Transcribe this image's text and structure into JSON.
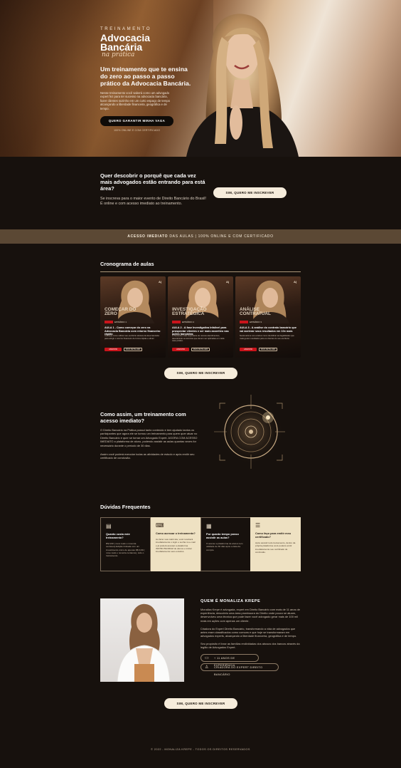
{
  "hero": {
    "eyebrow": "TREINAMENTO",
    "title_line1": "Advocacia",
    "title_line2": "Bancária",
    "script": "na prática",
    "headline": "Um treinamento que te ensina do zero ao passo a passo prático da Advocacia Bancária.",
    "body": "Nesse treinamento você saberá como um advogado expert fez para ter sucesso na advocacia bancária, fazer clientes sozinho em um curto espaço de tempo alcançando a liberdade financeira, geográfica e de tempo.",
    "cta": "QUERO GARANTIR MINHA VAGA",
    "note": "100% ONLINE E COM CERTIFICADO"
  },
  "why": {
    "heading": "Quer descobrir o porquê que cada vez mais advogados estão entrando para está área?",
    "body": "Se inscreva para o maior evento de Direito Bancário do Brasil! É online e com acesso imediato ao treinamento.",
    "cta": "SIM, QUERO ME INSCREVER"
  },
  "banner": {
    "bold": "ACESSO IMEDIATO",
    "rest": " DAS AULAS | 100% ONLINE E COM CERTIFICADO"
  },
  "schedule": {
    "title": "Cronograma de aulas",
    "cards": [
      {
        "big": "COMEÇAR DO ZERO",
        "tag": "EPISÓDIO 1",
        "title": "AULA 1 - Como começar do zero na Advocacia Bancária com retorno financeiro rápido",
        "desc": "Conheça como utilizar seu escritório através da área bancária para atingir o retorno financeiro de forma rápida e eficaz.",
        "btn1": "ASSISTIR",
        "btn2": "MAIS DETALHES",
        "logo": "A|"
      },
      {
        "big": "INVESTIGAÇÃO ESTRATÉGICA",
        "tag": "EPISÓDIO 2",
        "title": "AULA 2 - A fase Investigativa Infalível para prospectar clientes e ser mais assertivo nas ações bancárias",
        "desc": "O momento mais importante de nossos atendimentos, descobrindo as técnicas que devem ser aplicadas em cada caso prático.",
        "btn1": "ASSISTIR",
        "btn2": "MAIS DETALHES",
        "logo": "A|"
      },
      {
        "big": "ANÁLISE CONTRATUAL",
        "tag": "EPISÓDIO 3",
        "title": "AULA 3 - A análise do contrato bancário que vai acelerar seus resultados em 10x mais",
        "desc": "Nesta aula te vou ensinar como identificar as ilegalidades que mais geram resultados para os clientes do seu escritório.",
        "btn1": "ASSISTIR",
        "btn2": "MAIS DETALHES",
        "logo": "A|"
      }
    ],
    "cta": "SIM, QUERO ME INSCREVER"
  },
  "access": {
    "heading": "Como assim, um treinamento com acesso imediato?",
    "body": "O Direito Bancário na Prática possui tanto conteúdo e tem ajudado tantos os participantes que agora ele se tornou um treinamento para quem quer atuar no Direito Bancário e quer se tornar um Advogado Expert. AGORA COM ACESSO IMEDIATO a plataforma de aluno, podendo assistir as aulas quantas vezes for necessário durante o período de 30 dias.",
    "body2": "Assim você poderá executar todas as atividades de estudo e após emitir seu certificado de conclusão."
  },
  "faq": {
    "title": "Dúvidas Frequentes",
    "items": [
      {
        "icon": "money-icon",
        "glyph": "▤",
        "q": "Quanto custa este treinamento?",
        "a": "R$ 9,90 ( nove reais e noventa centavos) Edição limitada com um investimento único de apenas R$ 9,90 ( nove reais e noventa centavos), todo o treinamento."
      },
      {
        "icon": "laptop-icon",
        "glyph": "⌨",
        "q": "Como acessar o treinamento?",
        "a": "Ao fazer sua matrícula, você receberá imediatamente o login e senha no e-mail e já poderá acessar a plataforma INSTRUTEORIAZ de alunos e iniciar imediatamente seus estudos."
      },
      {
        "icon": "calendar-icon",
        "glyph": "▦",
        "q": "Por quanto tempo posso assistir as aulas?",
        "a": "O acesso a plataforma de alunos tem validade de 30 dias após a data da compra."
      },
      {
        "icon": "certificate-icon",
        "glyph": "☰",
        "q": "Como faço para emitir meu certificado?",
        "a": "Após assistir todo treinamento, dentro da própria plataforma você poderá emitir imediatamente seu certificado de conclusão."
      }
    ]
  },
  "about": {
    "heading": "QUEM É MONALIZA KREPE",
    "p1": "Monaliza Krepe é advogada, expert em Direito Bancário com mais de 11 anos de experiência, descobriu uma área promissora do Direito onde pouco se atuam, desenvolveu uma técnica que pode fazer você advogado gerar mais de 100 mil reais em ações com apenas um cliente.",
    "p2": "Criadora do Expert Direito Bancário, transformando a vida de advogados que antes eram classificados como comuns e que hoje se transformaram em advogados experts, alcançando a liberdade financeira, geográfica e de tempo.",
    "p3": "Seu propósito é livrar as famílias endividadas dos abusos dos bancos através da legião de Advogados Expert.",
    "badge1": "+ 11 ANOS DE EXPERIÊNCIA",
    "badge2": "CRIADORA DO EXPERT DIREITO BANCÁRIO",
    "cta": "SIM, QUERO ME INSCREVER"
  },
  "footer": "© 2022 - MONALIZA KREPE - TODOS OS DIREITOS RESERVADOS"
}
